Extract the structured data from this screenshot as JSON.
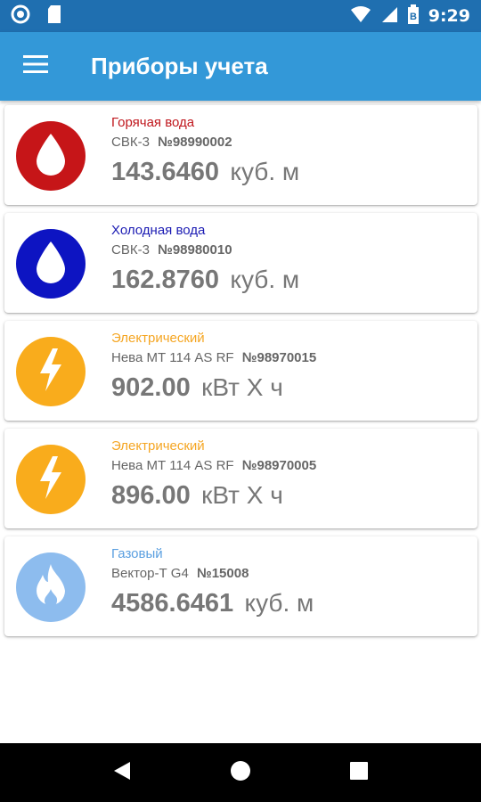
{
  "status_bar": {
    "time": "9:29",
    "battery_label": "B"
  },
  "app_bar": {
    "title": "Приборы учета",
    "menu_icon": "hamburger-menu-icon"
  },
  "meters": [
    {
      "type": "Горячая вода",
      "type_color": "#c0171d",
      "icon": "water-drop-icon",
      "icon_bg": "#c61518",
      "model": "СВК-3",
      "number": "№98990002",
      "value": "143.6460",
      "unit": "куб. м"
    },
    {
      "type": "Холодная вода",
      "type_color": "#1b1bb3",
      "icon": "water-drop-icon",
      "icon_bg": "#0d14c2",
      "model": "СВК-3",
      "number": "№98980010",
      "value": "162.8760",
      "unit": "куб. м"
    },
    {
      "type": "Электрический",
      "type_color": "#f5a623",
      "icon": "lightning-icon",
      "icon_bg": "#f9ac1c",
      "model": "Нева МТ 114 AS RF",
      "number": "№98970015",
      "value": "902.00",
      "unit": "кВт Х ч"
    },
    {
      "type": "Электрический",
      "type_color": "#f5a623",
      "icon": "lightning-icon",
      "icon_bg": "#f9ac1c",
      "model": "Нева МТ 114 AS RF",
      "number": "№98970005",
      "value": "896.00",
      "unit": "кВт Х ч"
    },
    {
      "type": "Газовый",
      "type_color": "#5a9fe0",
      "icon": "flame-icon",
      "icon_bg": "#8dbcee",
      "model": "Вектор-Т G4",
      "number": "№15008",
      "value": "4586.6461",
      "unit": "куб. м"
    }
  ],
  "nav_bar": {
    "back_icon": "back-triangle-icon",
    "home_icon": "home-circle-icon",
    "recents_icon": "recents-square-icon"
  }
}
